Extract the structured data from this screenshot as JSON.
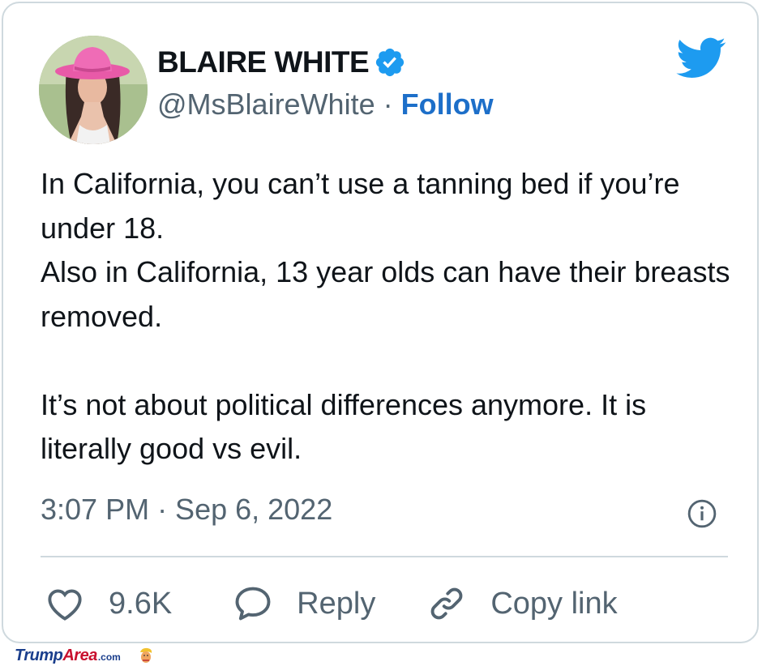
{
  "tweet": {
    "display_name": "BLAIRE WHITE",
    "handle": "@MsBlaireWhite",
    "separator": " · ",
    "follow_label": "Follow",
    "text_lines": [
      "In California, you can’t use a tanning bed if you’re under 18.",
      "Also in California, 13 year olds can have their breasts removed.",
      "",
      "It’s not about political differences anymore. It is literally good vs evil."
    ],
    "timestamp": "3:07 PM · Sep 6, 2022",
    "likes_count": "9.6K",
    "reply_label": "Reply",
    "copy_link_label": "Copy link"
  },
  "icons": {
    "verified": "verified-badge-icon",
    "brand": "twitter-bird-icon",
    "info": "info-icon",
    "like": "heart-icon",
    "reply": "speech-bubble-icon",
    "copy": "link-icon"
  },
  "watermark": {
    "brand_part1": "Trump",
    "brand_part2": "Area",
    "brand_suffix": ".com"
  },
  "colors": {
    "accent_blue": "#1d9bf0",
    "follow_blue": "#1d6fc9",
    "text_primary": "#0f1419",
    "text_secondary": "#536471",
    "border": "#cfd9de"
  }
}
